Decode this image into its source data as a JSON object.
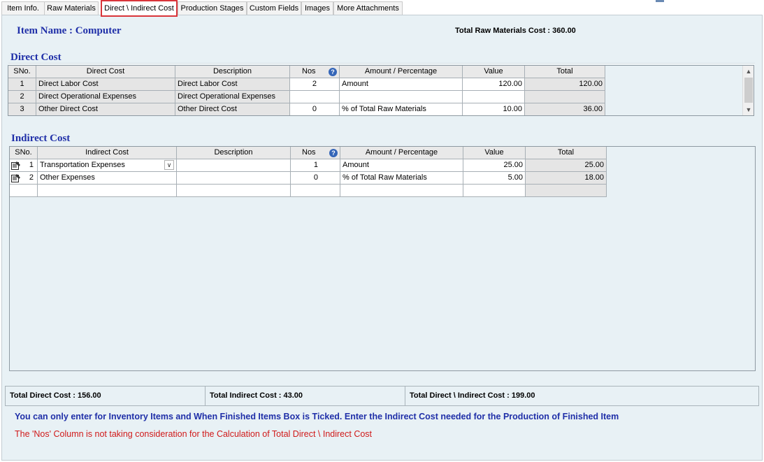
{
  "tabs": [
    {
      "label": "Item Info."
    },
    {
      "label": "Raw Materials"
    },
    {
      "label": "Direct \\ Indirect Cost"
    },
    {
      "label": "Production Stages"
    },
    {
      "label": "Custom Fields"
    },
    {
      "label": "Images"
    },
    {
      "label": "More Attachments"
    }
  ],
  "active_tab": "Direct \\ Indirect Cost",
  "item": {
    "name": "Item Name : Computer"
  },
  "total_raw_materials_cost": "Total Raw Materials Cost : 360.00",
  "direct": {
    "title": "Direct Cost",
    "headers": [
      "SNo.",
      "Direct Cost",
      "Description",
      "Nos",
      "Amount / Percentage",
      "Value",
      "Total"
    ],
    "rows": [
      {
        "sno": "1",
        "cost": "Direct Labor Cost",
        "desc": "Direct Labor Cost",
        "nos": "2",
        "amt": "Amount",
        "value": "120.00",
        "total": "120.00"
      },
      {
        "sno": "2",
        "cost": "Direct Operational Expenses",
        "desc": "Direct Operational Expenses",
        "nos": "",
        "amt": "",
        "value": "",
        "total": ""
      },
      {
        "sno": "3",
        "cost": "Other Direct Cost",
        "desc": "Other Direct Cost",
        "nos": "0",
        "amt": "% of Total Raw Materials",
        "value": "10.00",
        "total": "36.00"
      }
    ]
  },
  "indirect": {
    "title": "Indirect Cost",
    "headers": [
      "SNo.",
      "Indirect Cost",
      "Description",
      "Nos",
      "Amount / Percentage",
      "Value",
      "Total"
    ],
    "rows": [
      {
        "sno": "1",
        "cost": "Transportation Expenses",
        "desc": "",
        "nos": "1",
        "amt": "Amount",
        "value": "25.00",
        "total": "25.00"
      },
      {
        "sno": "2",
        "cost": "Other Expenses",
        "desc": "",
        "nos": "0",
        "amt": "% of Total Raw Materials",
        "value": "5.00",
        "total": "18.00"
      },
      {
        "sno": "",
        "cost": "",
        "desc": "",
        "nos": "",
        "amt": "",
        "value": "",
        "total": ""
      }
    ]
  },
  "totals": {
    "direct": "Total Direct Cost : 156.00",
    "indirect": "Total Indirect Cost : 43.00",
    "combined": "Total Direct \\ Indirect Cost : 199.00"
  },
  "notes": {
    "info": "You can only enter for Inventory Items and When Finished Items Box is Ticked. Enter the Indirect Cost needed for the Production of Finished Item",
    "warning": "The 'Nos' Column is not taking consideration for the Calculation of Total Direct \\ Indirect Cost"
  },
  "colors": {
    "accent_blue": "#1f2fa8",
    "warning_red": "#d01919",
    "active_tab_border": "#d9353a",
    "panel_bg": "#e8f1f5"
  },
  "icons": {
    "help": "question-circle-icon",
    "row": "edit-row-icon",
    "dropdown": "chevron-down-icon",
    "scroll_up": "scroll-up-arrow",
    "scroll_down": "scroll-down-arrow"
  }
}
